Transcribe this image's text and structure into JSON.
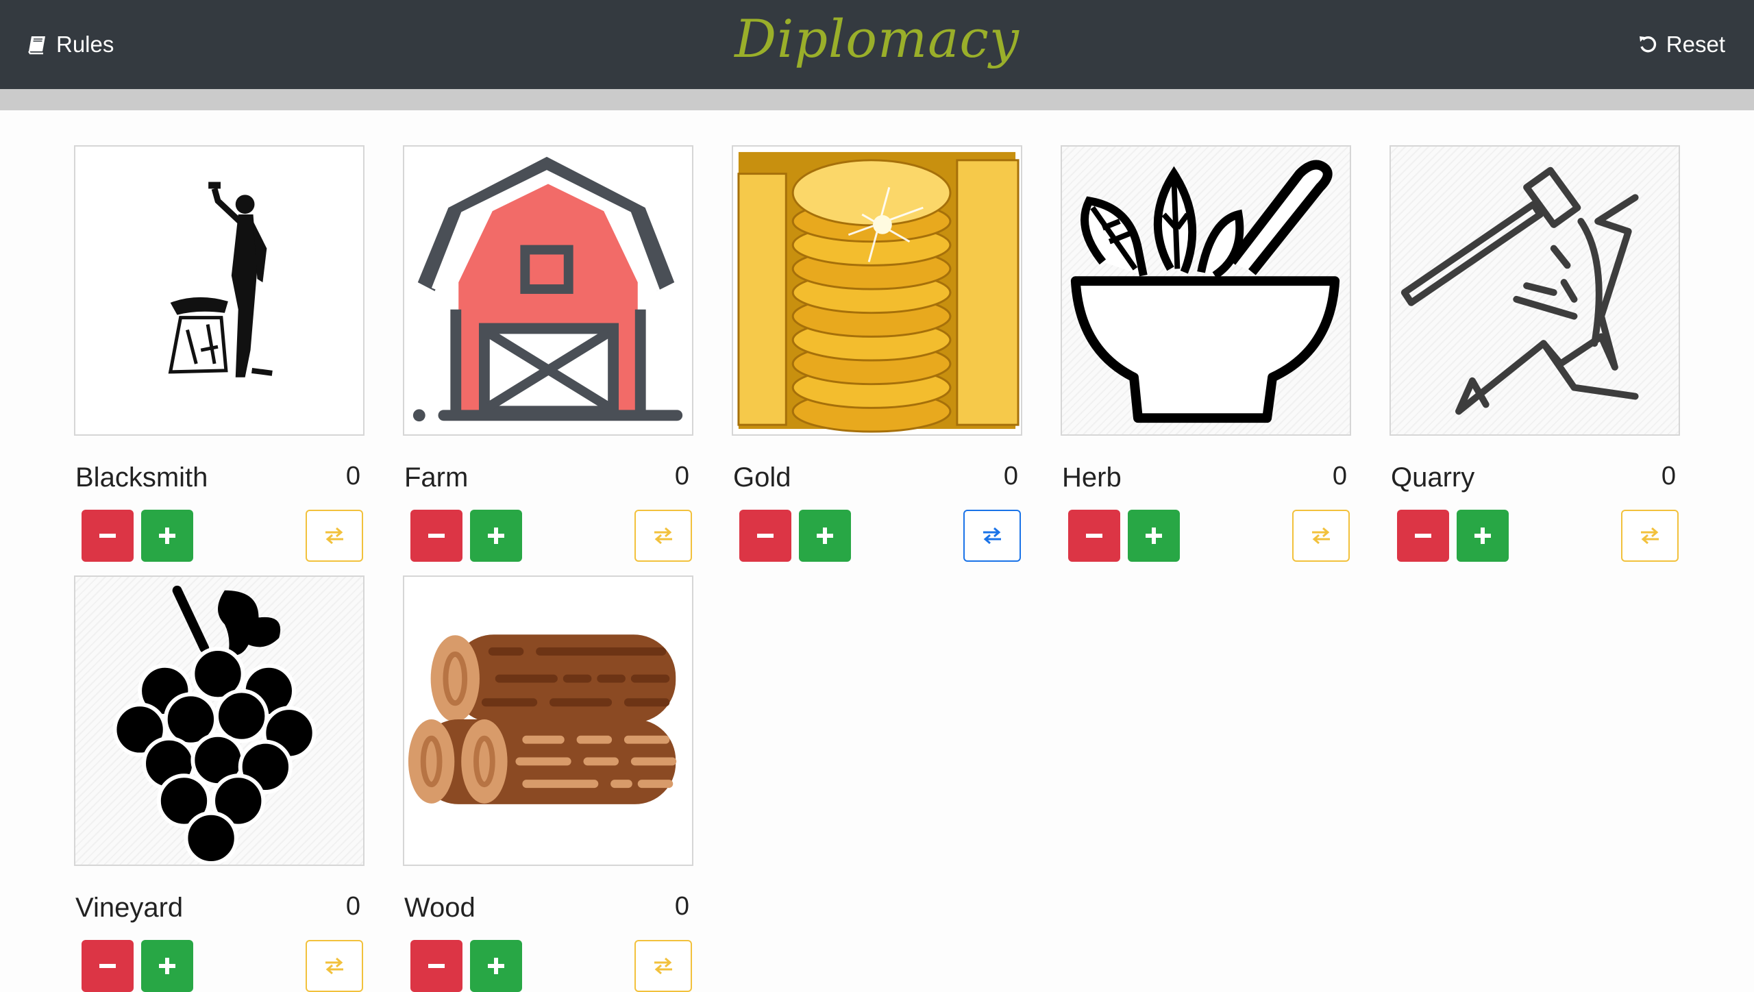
{
  "navbar": {
    "rules_label": "Rules",
    "brand": "Diplomacy",
    "reset_label": "Reset"
  },
  "colors": {
    "navbar_bg": "#343a40",
    "brand": "#9aaf2a",
    "minus": "#dc3545",
    "plus": "#28a745",
    "trade": "#f2c13c",
    "trade_selected": "#1a73e8"
  },
  "resources": [
    {
      "name": "Blacksmith",
      "count": "0",
      "icon": "blacksmith-icon",
      "trade_selected": false
    },
    {
      "name": "Farm",
      "count": "0",
      "icon": "barn-icon",
      "trade_selected": false
    },
    {
      "name": "Gold",
      "count": "0",
      "icon": "gold-coins-icon",
      "trade_selected": true
    },
    {
      "name": "Herb",
      "count": "0",
      "icon": "mortar-pestle-herbs-icon",
      "trade_selected": false
    },
    {
      "name": "Quarry",
      "count": "0",
      "icon": "pickaxe-rock-icon",
      "trade_selected": false
    },
    {
      "name": "Vineyard",
      "count": "0",
      "icon": "grapes-icon",
      "trade_selected": false
    },
    {
      "name": "Wood",
      "count": "0",
      "icon": "logs-icon",
      "trade_selected": false
    }
  ]
}
